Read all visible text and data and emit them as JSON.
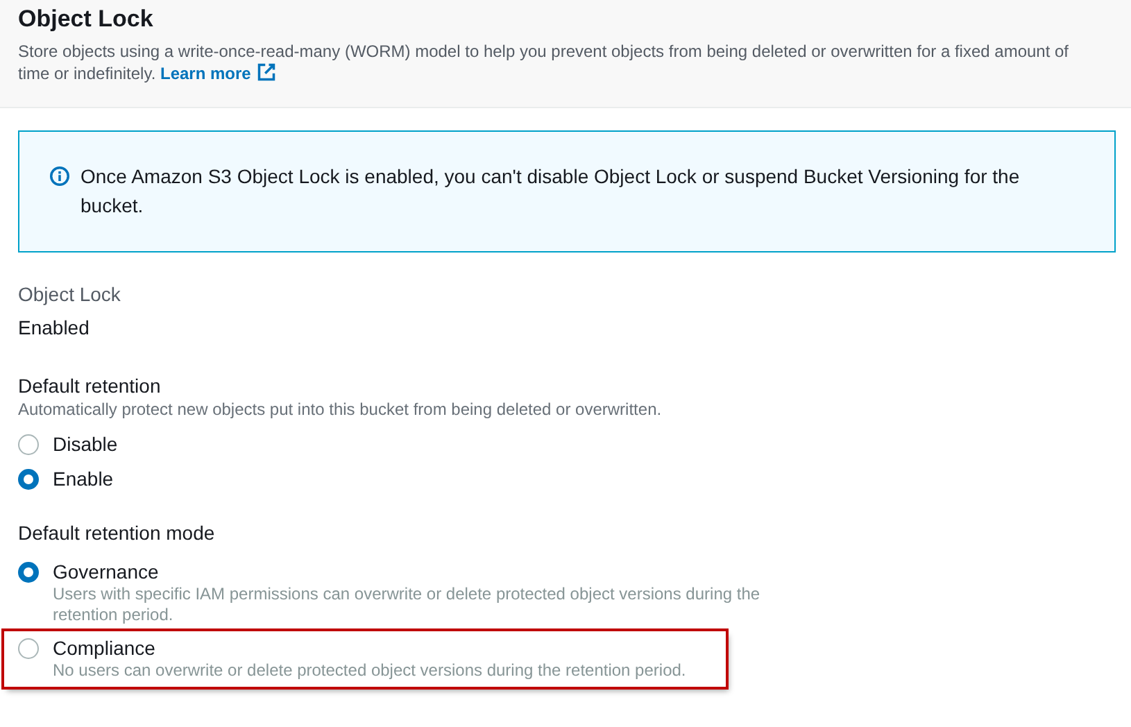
{
  "header": {
    "title": "Object Lock",
    "description": "Store objects using a write-once-read-many (WORM) model to help you prevent objects from being deleted or overwritten for a fixed amount of time or indefinitely.",
    "link": "Learn more"
  },
  "info_alert": {
    "message": "Once Amazon S3 Object Lock is enabled, you can't disable Object Lock or suspend Bucket Versioning for the bucket."
  },
  "object_lock": {
    "label": "Object Lock",
    "value": "Enabled"
  },
  "default_retention": {
    "label": "Default retention",
    "description": "Automatically protect new objects put into this bucket from being deleted or overwritten.",
    "options": [
      {
        "label": "Disable",
        "selected": false
      },
      {
        "label": "Enable",
        "selected": true
      }
    ]
  },
  "retention_mode": {
    "label": "Default retention mode",
    "options": [
      {
        "label": "Governance",
        "description": "Users with specific IAM permissions can overwrite or delete protected object versions during the retention period.",
        "selected": true,
        "highlighted": false
      },
      {
        "label": "Compliance",
        "description": "No users can overwrite or delete protected object versions during the retention period.",
        "selected": false,
        "highlighted": true
      }
    ]
  }
}
